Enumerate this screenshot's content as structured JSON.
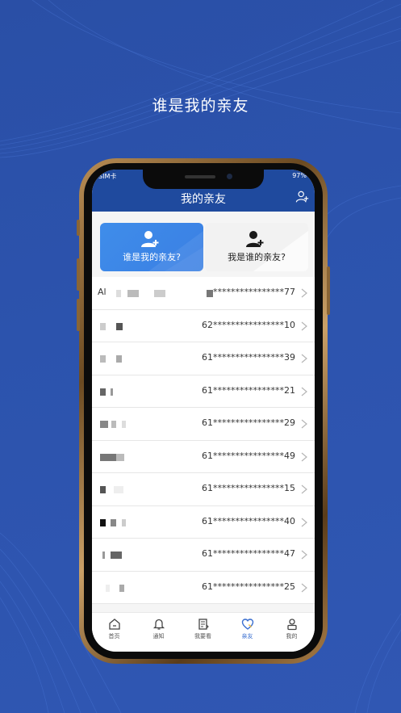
{
  "headline": "谁是我的亲友",
  "status": {
    "left": "SIM卡",
    "right": "97%"
  },
  "appbar": {
    "title": "我的亲友",
    "action_icon": "add-user-icon"
  },
  "tabs": [
    {
      "label": "谁是我的亲友?",
      "icon": "add-user-icon",
      "active": true
    },
    {
      "label": "我是谁的亲友?",
      "icon": "add-user-icon",
      "active": false
    }
  ],
  "contacts": [
    {
      "name_prefix": "Al",
      "phone": "****************77"
    },
    {
      "name_prefix": "",
      "phone": "62****************10"
    },
    {
      "name_prefix": "",
      "phone": "61****************39"
    },
    {
      "name_prefix": "",
      "phone": "61****************21"
    },
    {
      "name_prefix": "",
      "phone": "61****************29"
    },
    {
      "name_prefix": "",
      "phone": "61****************49"
    },
    {
      "name_prefix": "",
      "phone": "61****************15"
    },
    {
      "name_prefix": "",
      "phone": "61****************40"
    },
    {
      "name_prefix": "",
      "phone": "61****************47"
    },
    {
      "name_prefix": "",
      "phone": "61****************25"
    }
  ],
  "bottom_nav": [
    {
      "label": "首页",
      "icon": "home-icon",
      "active": false
    },
    {
      "label": "通知",
      "icon": "bell-icon",
      "active": false
    },
    {
      "label": "我要看",
      "icon": "document-icon",
      "active": false
    },
    {
      "label": "亲友",
      "icon": "heart-icon",
      "active": true
    },
    {
      "label": "我的",
      "icon": "person-icon",
      "active": false
    }
  ],
  "colors": {
    "background": "#2c53ad",
    "appbar": "#1f4a9e",
    "tab_active": "#3f8dea",
    "nav_active": "#3a6fd0",
    "phone_frame": "#b88d55"
  }
}
